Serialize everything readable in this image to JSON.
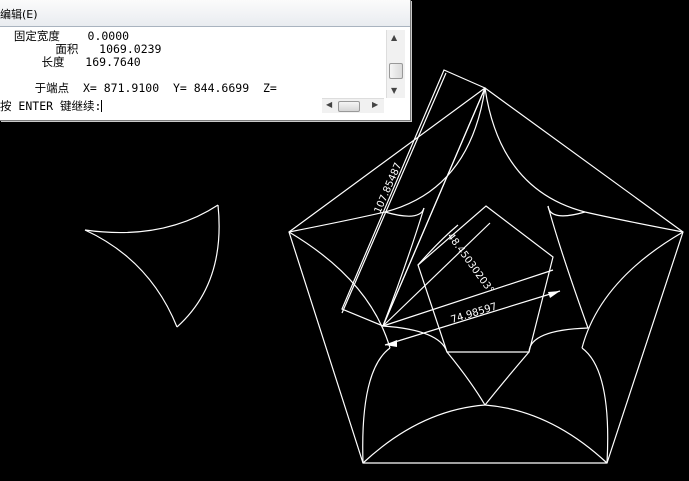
{
  "text_window": {
    "menu_label": "编辑(E)",
    "history": [
      "  固定宽度    0.0000",
      "        面积   1069.0239",
      "      长度   169.7640",
      "",
      "     于端点  X= 871.9100  Y= 844.6699  Z="
    ],
    "prompt": "按 ENTER 键继续:"
  },
  "dimensions": {
    "long": "107.85487",
    "mid": "74.98597",
    "angle": "48.45030203°"
  },
  "colors": {
    "drawing_background": "#000000",
    "line": "#ffffff"
  },
  "icons": {
    "scroll_up": "▲",
    "scroll_down": "▼",
    "scroll_left": "◀",
    "scroll_right": "▶"
  }
}
